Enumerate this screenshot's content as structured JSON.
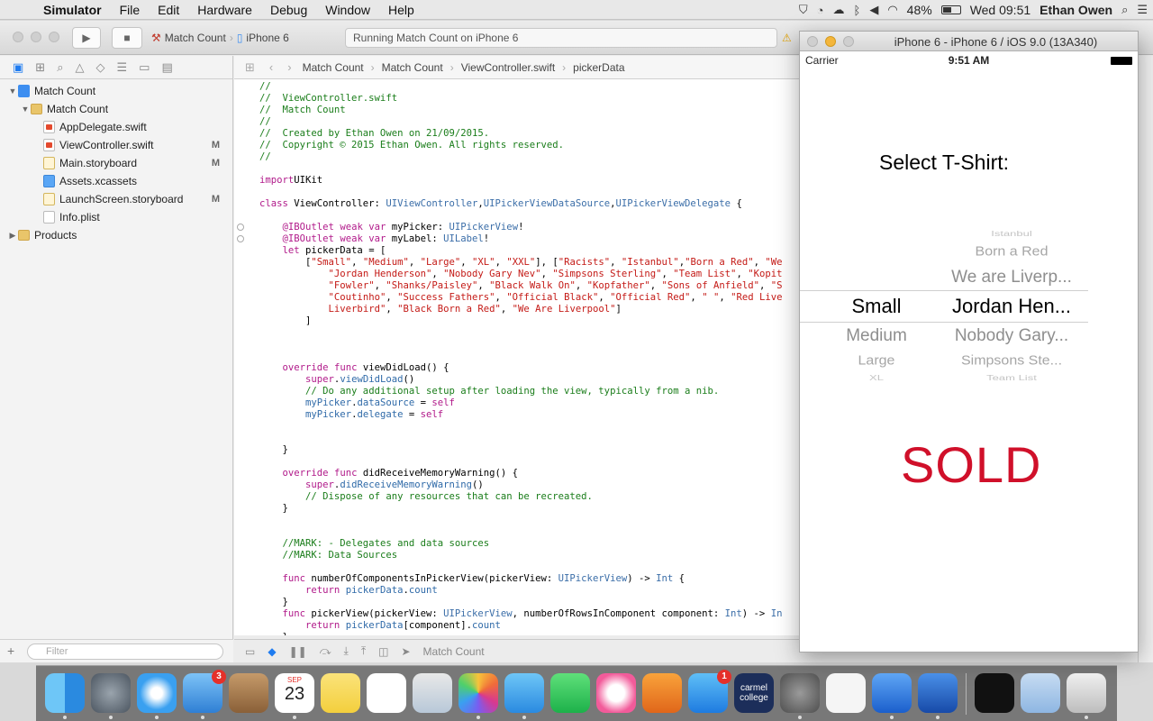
{
  "menubar": {
    "app_name": "Simulator",
    "items": [
      "File",
      "Edit",
      "Hardware",
      "Debug",
      "Window",
      "Help"
    ],
    "battery_text": "48%",
    "clock": "Wed 09:51",
    "user": "Ethan Owen"
  },
  "toolbar": {
    "scheme": "Match Count",
    "device": "iPhone 6",
    "status": "Running Match Count on iPhone 6"
  },
  "navigator": {
    "tree": [
      {
        "label": "Match Count",
        "icon": "project",
        "indent": 0,
        "disclosure": "open",
        "badge": ""
      },
      {
        "label": "Match Count",
        "icon": "folder",
        "indent": 1,
        "disclosure": "open",
        "badge": ""
      },
      {
        "label": "AppDelegate.swift",
        "icon": "swift",
        "indent": 2,
        "disclosure": "",
        "badge": ""
      },
      {
        "label": "ViewController.swift",
        "icon": "swift",
        "indent": 2,
        "disclosure": "",
        "badge": "M"
      },
      {
        "label": "Main.storyboard",
        "icon": "storyboard",
        "indent": 2,
        "disclosure": "",
        "badge": "M"
      },
      {
        "label": "Assets.xcassets",
        "icon": "assets",
        "indent": 2,
        "disclosure": "",
        "badge": ""
      },
      {
        "label": "LaunchScreen.storyboard",
        "icon": "storyboard",
        "indent": 2,
        "disclosure": "",
        "badge": "M"
      },
      {
        "label": "Info.plist",
        "icon": "plist",
        "indent": 2,
        "disclosure": "",
        "badge": ""
      },
      {
        "label": "Products",
        "icon": "folder",
        "indent": 0,
        "disclosure": "closed",
        "badge": ""
      }
    ],
    "filter_placeholder": "Filter"
  },
  "jumpbar": {
    "crumbs": [
      "Match Count",
      "Match Count",
      "ViewController.swift",
      "pickerData"
    ]
  },
  "code_lines": [
    [
      [
        "c-cmt",
        "//"
      ]
    ],
    [
      [
        "c-cmt",
        "//  ViewController.swift"
      ]
    ],
    [
      [
        "c-cmt",
        "//  Match Count"
      ]
    ],
    [
      [
        "c-cmt",
        "//"
      ]
    ],
    [
      [
        "c-cmt",
        "//  Created by Ethan Owen on 21/09/2015."
      ]
    ],
    [
      [
        "c-cmt",
        "//  Copyright © 2015 Ethan Owen. All rights reserved."
      ]
    ],
    [
      [
        "c-cmt",
        "//"
      ]
    ],
    [],
    [
      [
        "c-kw",
        "import"
      ],
      [
        "",
        "UIKit"
      ]
    ],
    [],
    [
      [
        "c-kw",
        "class"
      ],
      [
        "",
        " ViewController: "
      ],
      [
        "c-type",
        "UIViewController"
      ],
      [
        "",
        ","
      ],
      [
        "c-type",
        "UIPickerViewDataSource"
      ],
      [
        "",
        ","
      ],
      [
        "c-type",
        "UIPickerViewDelegate"
      ],
      [
        "",
        " {"
      ]
    ],
    [],
    [
      [
        "",
        "    "
      ],
      [
        "c-kw",
        "@IBOutlet"
      ],
      [
        "",
        " "
      ],
      [
        "c-kw",
        "weak"
      ],
      [
        "",
        " "
      ],
      [
        "c-kw",
        "var"
      ],
      [
        "",
        " myPicker: "
      ],
      [
        "c-type",
        "UIPickerView"
      ],
      [
        "",
        "!"
      ]
    ],
    [
      [
        "",
        "    "
      ],
      [
        "c-kw",
        "@IBOutlet"
      ],
      [
        "",
        " "
      ],
      [
        "c-kw",
        "weak"
      ],
      [
        "",
        " "
      ],
      [
        "c-kw",
        "var"
      ],
      [
        "",
        " myLabel: "
      ],
      [
        "c-type",
        "UILabel"
      ],
      [
        "",
        "!"
      ]
    ],
    [
      [
        "",
        "    "
      ],
      [
        "c-kw",
        "let"
      ],
      [
        "",
        " pickerData = ["
      ]
    ],
    [
      [
        "",
        "        ["
      ],
      [
        "c-str",
        "\"Small\""
      ],
      [
        "",
        ", "
      ],
      [
        "c-str",
        "\"Medium\""
      ],
      [
        "",
        ", "
      ],
      [
        "c-str",
        "\"Large\""
      ],
      [
        "",
        ", "
      ],
      [
        "c-str",
        "\"XL\""
      ],
      [
        "",
        ", "
      ],
      [
        "c-str",
        "\"XXL\""
      ],
      [
        "",
        "], ["
      ],
      [
        "c-str",
        "\"Racists\""
      ],
      [
        "",
        ", "
      ],
      [
        "c-str",
        "\"Istanbul\""
      ],
      [
        "",
        ","
      ],
      [
        "c-str",
        "\"Born a Red\""
      ],
      [
        "",
        ", "
      ],
      [
        "c-str",
        "\"We"
      ]
    ],
    [
      [
        "",
        "            "
      ],
      [
        "c-str",
        "\"Jordan Henderson\""
      ],
      [
        "",
        ", "
      ],
      [
        "c-str",
        "\"Nobody Gary Nev\""
      ],
      [
        "",
        ", "
      ],
      [
        "c-str",
        "\"Simpsons Sterling\""
      ],
      [
        "",
        ", "
      ],
      [
        "c-str",
        "\"Team List\""
      ],
      [
        "",
        ", "
      ],
      [
        "c-str",
        "\"Kopit"
      ]
    ],
    [
      [
        "",
        "            "
      ],
      [
        "c-str",
        "\"Fowler\""
      ],
      [
        "",
        ", "
      ],
      [
        "c-str",
        "\"Shanks/Paisley\""
      ],
      [
        "",
        ", "
      ],
      [
        "c-str",
        "\"Black Walk On\""
      ],
      [
        "",
        ", "
      ],
      [
        "c-str",
        "\"Kopfather\""
      ],
      [
        "",
        ", "
      ],
      [
        "c-str",
        "\"Sons of Anfield\""
      ],
      [
        "",
        ", "
      ],
      [
        "c-str",
        "\"S"
      ]
    ],
    [
      [
        "",
        "            "
      ],
      [
        "c-str",
        "\"Coutinho\""
      ],
      [
        "",
        ", "
      ],
      [
        "c-str",
        "\"Success Fathers\""
      ],
      [
        "",
        ", "
      ],
      [
        "c-str",
        "\"Official Black\""
      ],
      [
        "",
        ", "
      ],
      [
        "c-str",
        "\"Official Red\""
      ],
      [
        "",
        ", "
      ],
      [
        "c-str",
        "\" \""
      ],
      [
        "",
        ", "
      ],
      [
        "c-str",
        "\"Red Live"
      ]
    ],
    [
      [
        "",
        "            "
      ],
      [
        "c-str",
        "Liverbird\""
      ],
      [
        "",
        ", "
      ],
      [
        "c-str",
        "\"Black Born a Red\""
      ],
      [
        "",
        ", "
      ],
      [
        "c-str",
        "\"We Are Liverpool\""
      ],
      [
        "",
        "]"
      ]
    ],
    [
      [
        "",
        "        ]"
      ]
    ],
    [],
    [],
    [],
    [
      [
        "",
        "    "
      ],
      [
        "c-kw",
        "override"
      ],
      [
        "",
        " "
      ],
      [
        "c-kw",
        "func"
      ],
      [
        "",
        " viewDidLoad() {"
      ]
    ],
    [
      [
        "",
        "        "
      ],
      [
        "c-kw",
        "super"
      ],
      [
        "",
        "."
      ],
      [
        "c-fn",
        "viewDidLoad"
      ],
      [
        "",
        "()"
      ]
    ],
    [
      [
        "",
        "        "
      ],
      [
        "c-cmt",
        "// Do any additional setup after loading the view, typically from a nib."
      ]
    ],
    [
      [
        "",
        "        "
      ],
      [
        "c-fn",
        "myPicker"
      ],
      [
        "",
        "."
      ],
      [
        "c-fn",
        "dataSource"
      ],
      [
        "",
        " = "
      ],
      [
        "c-kw",
        "self"
      ]
    ],
    [
      [
        "",
        "        "
      ],
      [
        "c-fn",
        "myPicker"
      ],
      [
        "",
        "."
      ],
      [
        "c-fn",
        "delegate"
      ],
      [
        "",
        " = "
      ],
      [
        "c-kw",
        "self"
      ]
    ],
    [],
    [],
    [
      [
        "",
        "    }"
      ]
    ],
    [],
    [
      [
        "",
        "    "
      ],
      [
        "c-kw",
        "override"
      ],
      [
        "",
        " "
      ],
      [
        "c-kw",
        "func"
      ],
      [
        "",
        " didReceiveMemoryWarning() {"
      ]
    ],
    [
      [
        "",
        "        "
      ],
      [
        "c-kw",
        "super"
      ],
      [
        "",
        "."
      ],
      [
        "c-fn",
        "didReceiveMemoryWarning"
      ],
      [
        "",
        "()"
      ]
    ],
    [
      [
        "",
        "        "
      ],
      [
        "c-cmt",
        "// Dispose of any resources that can be recreated."
      ]
    ],
    [
      [
        "",
        "    }"
      ]
    ],
    [],
    [],
    [
      [
        "",
        "    "
      ],
      [
        "c-cmt",
        "//MARK: - Delegates and data sources"
      ]
    ],
    [
      [
        "",
        "    "
      ],
      [
        "c-cmt",
        "//MARK: Data Sources"
      ]
    ],
    [],
    [
      [
        "",
        "    "
      ],
      [
        "c-kw",
        "func"
      ],
      [
        "",
        " numberOfComponentsInPickerView(pickerView: "
      ],
      [
        "c-type",
        "UIPickerView"
      ],
      [
        "",
        ") -> "
      ],
      [
        "c-type",
        "Int"
      ],
      [
        "",
        " {"
      ]
    ],
    [
      [
        "",
        "        "
      ],
      [
        "c-kw",
        "return"
      ],
      [
        "",
        " "
      ],
      [
        "c-fn",
        "pickerData"
      ],
      [
        "",
        "."
      ],
      [
        "c-fn",
        "count"
      ]
    ],
    [
      [
        "",
        "    }"
      ]
    ],
    [
      [
        "",
        "    "
      ],
      [
        "c-kw",
        "func"
      ],
      [
        "",
        " pickerView(pickerView: "
      ],
      [
        "c-type",
        "UIPickerView"
      ],
      [
        "",
        ", numberOfRowsInComponent component: "
      ],
      [
        "c-type",
        "Int"
      ],
      [
        "",
        ") -> "
      ],
      [
        "c-type",
        "In"
      ]
    ],
    [
      [
        "",
        "        "
      ],
      [
        "c-kw",
        "return"
      ],
      [
        "",
        " "
      ],
      [
        "c-fn",
        "pickerData"
      ],
      [
        "",
        "[component]."
      ],
      [
        "c-fn",
        "count"
      ]
    ],
    [
      [
        "",
        "    }"
      ]
    ]
  ],
  "debugbar": {
    "target": "Match Count"
  },
  "simulator": {
    "title": "iPhone 6 - iPhone 6 / iOS 9.0 (13A340)",
    "carrier": "Carrier",
    "time": "9:51 AM",
    "heading": "Select T-Shirt:",
    "picker_left": [
      "Small",
      "Medium",
      "Large",
      "XL"
    ],
    "picker_right_above": [
      "Istanbul",
      "Born a Red",
      "We are Liverp..."
    ],
    "picker_right_selected": "Jordan Hen...",
    "picker_right_below": [
      "Nobody Gary...",
      "Simpsons Ste...",
      "Team List"
    ],
    "sold_label": "SOLD"
  },
  "dock": {
    "apps": [
      "Finder",
      "Launchpad",
      "Safari",
      "Mail",
      "Contacts",
      "Calendar",
      "Notes",
      "Reminders",
      "Preview",
      "Photos",
      "Messages",
      "FaceTime",
      "iTunes",
      "iBooks",
      "App Store",
      "carmel college",
      "System Preferences",
      "TextEdit",
      "Xcode",
      "Simulator",
      "Downloads",
      "Folder",
      "Trash"
    ],
    "calendar_month": "SEP",
    "calendar_day": "23",
    "mail_badge": "3",
    "appstore_badge": "1",
    "carmel_text": "carmel college"
  },
  "colors": {
    "sold": "#d0102a",
    "accent": "#1f7cf0"
  }
}
